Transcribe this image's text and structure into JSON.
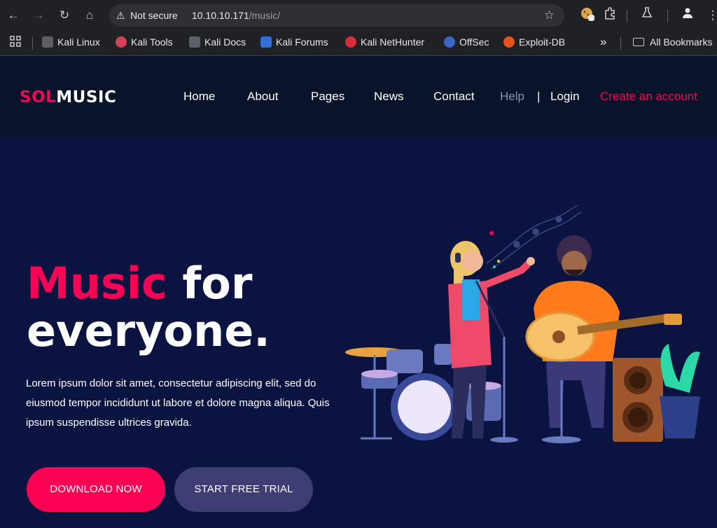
{
  "browser": {
    "security_label": "Not secure",
    "url_host": "10.10.10.171",
    "url_path": "/music/",
    "bookmarks": [
      {
        "label": "Kali Linux",
        "color": "#5a5f68"
      },
      {
        "label": "Kali Tools",
        "color": "#d4405a"
      },
      {
        "label": "Kali Docs",
        "color": "#5a5f68"
      },
      {
        "label": "Kali Forums",
        "color": "#2f6fd6"
      },
      {
        "label": "Kali NetHunter",
        "color": "#d62d3a"
      },
      {
        "label": "OffSec",
        "color": "#3a66c8"
      },
      {
        "label": "Exploit-DB",
        "color": "#e2541c"
      }
    ],
    "more_label": "»",
    "all_bookmarks_label": "All Bookmarks"
  },
  "site": {
    "logo_first": "SOL",
    "logo_second": "MUSIC",
    "nav": [
      "Home",
      "About",
      "Pages",
      "News",
      "Contact"
    ],
    "help_label": "Help",
    "divider": "|",
    "login_label": "Login",
    "create_account_label": "Create an account",
    "colors": {
      "accent": "#fc0254",
      "header_bg": "#07142a",
      "hero_bg": "#0b1440",
      "secondary_button": "#3d3c73"
    }
  },
  "hero": {
    "title_accent": "Music",
    "title_rest_1": " for",
    "title_rest_2": "everyone.",
    "description": "Lorem ipsum dolor sit amet, consectetur adipiscing elit, sed do eiusmod tempor incididunt ut labore et dolore magna aliqua. Quis ipsum suspendisse ultrices gravida.",
    "download_label": "DOWNLOAD NOW",
    "trial_label": "START FREE TRIAL"
  }
}
